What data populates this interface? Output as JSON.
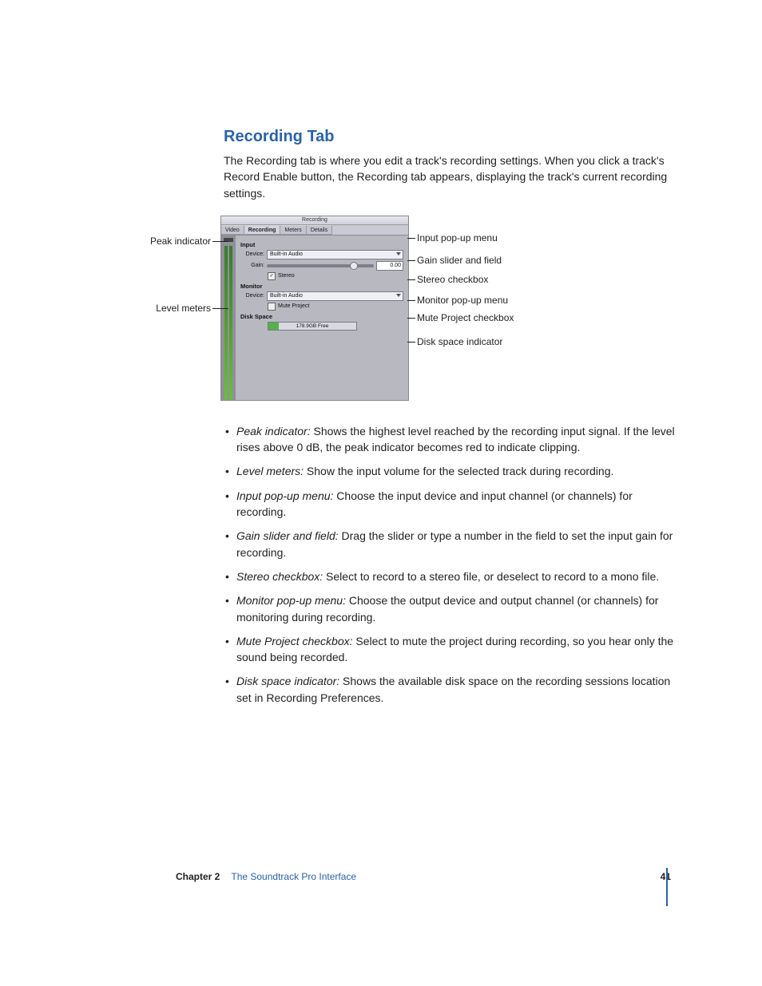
{
  "heading": "Recording Tab",
  "intro": "The Recording tab is where you edit a track's recording settings. When you click a track's Record Enable button, the Recording tab appears, displaying the track's current recording settings.",
  "screenshot": {
    "window_title": "Recording",
    "tabs": [
      "Video",
      "Recording",
      "Meters",
      "Details"
    ],
    "active_tab": 1,
    "input_section": "Input",
    "device_label": "Device:",
    "input_device": "Built-in Audio",
    "gain_label": "Gain:",
    "gain_value": "0.00",
    "stereo_label": "Stereo",
    "monitor_section": "Monitor",
    "monitor_device": "Built-in Audio",
    "mute_label": "Mute Project",
    "disk_section": "Disk Space",
    "disk_text": "178.9GB Free"
  },
  "callouts": {
    "left": {
      "peak": "Peak indicator",
      "meters": "Level meters"
    },
    "right": {
      "input_menu": "Input pop-up menu",
      "gain": "Gain slider and field",
      "stereo": "Stereo checkbox",
      "monitor_menu": "Monitor pop-up menu",
      "mute": "Mute Project checkbox",
      "disk": "Disk space indicator"
    }
  },
  "bullets": [
    {
      "term": "Peak indicator:",
      "desc": "  Shows the highest level reached by the recording input signal. If the level rises above 0 dB, the peak indicator becomes red to indicate clipping."
    },
    {
      "term": "Level meters:",
      "desc": "  Show the input volume for the selected track during recording."
    },
    {
      "term": "Input pop-up menu:",
      "desc": "  Choose the input device and input channel (or channels) for recording."
    },
    {
      "term": "Gain slider and field:",
      "desc": "  Drag the slider or type a number in the field to set the input gain for recording."
    },
    {
      "term": "Stereo checkbox:",
      "desc": "  Select to record to a stereo file, or deselect to record to a mono file."
    },
    {
      "term": "Monitor pop-up menu:",
      "desc": "  Choose the output device and output channel (or channels) for monitoring during recording."
    },
    {
      "term": "Mute Project checkbox:",
      "desc": "  Select to mute the project during recording, so you hear only the sound being recorded."
    },
    {
      "term": "Disk space indicator:",
      "desc": "  Shows the available disk space on the recording sessions location set in Recording Preferences."
    }
  ],
  "footer": {
    "chapter": "Chapter 2",
    "title": "The Soundtrack Pro Interface",
    "page": "41"
  }
}
